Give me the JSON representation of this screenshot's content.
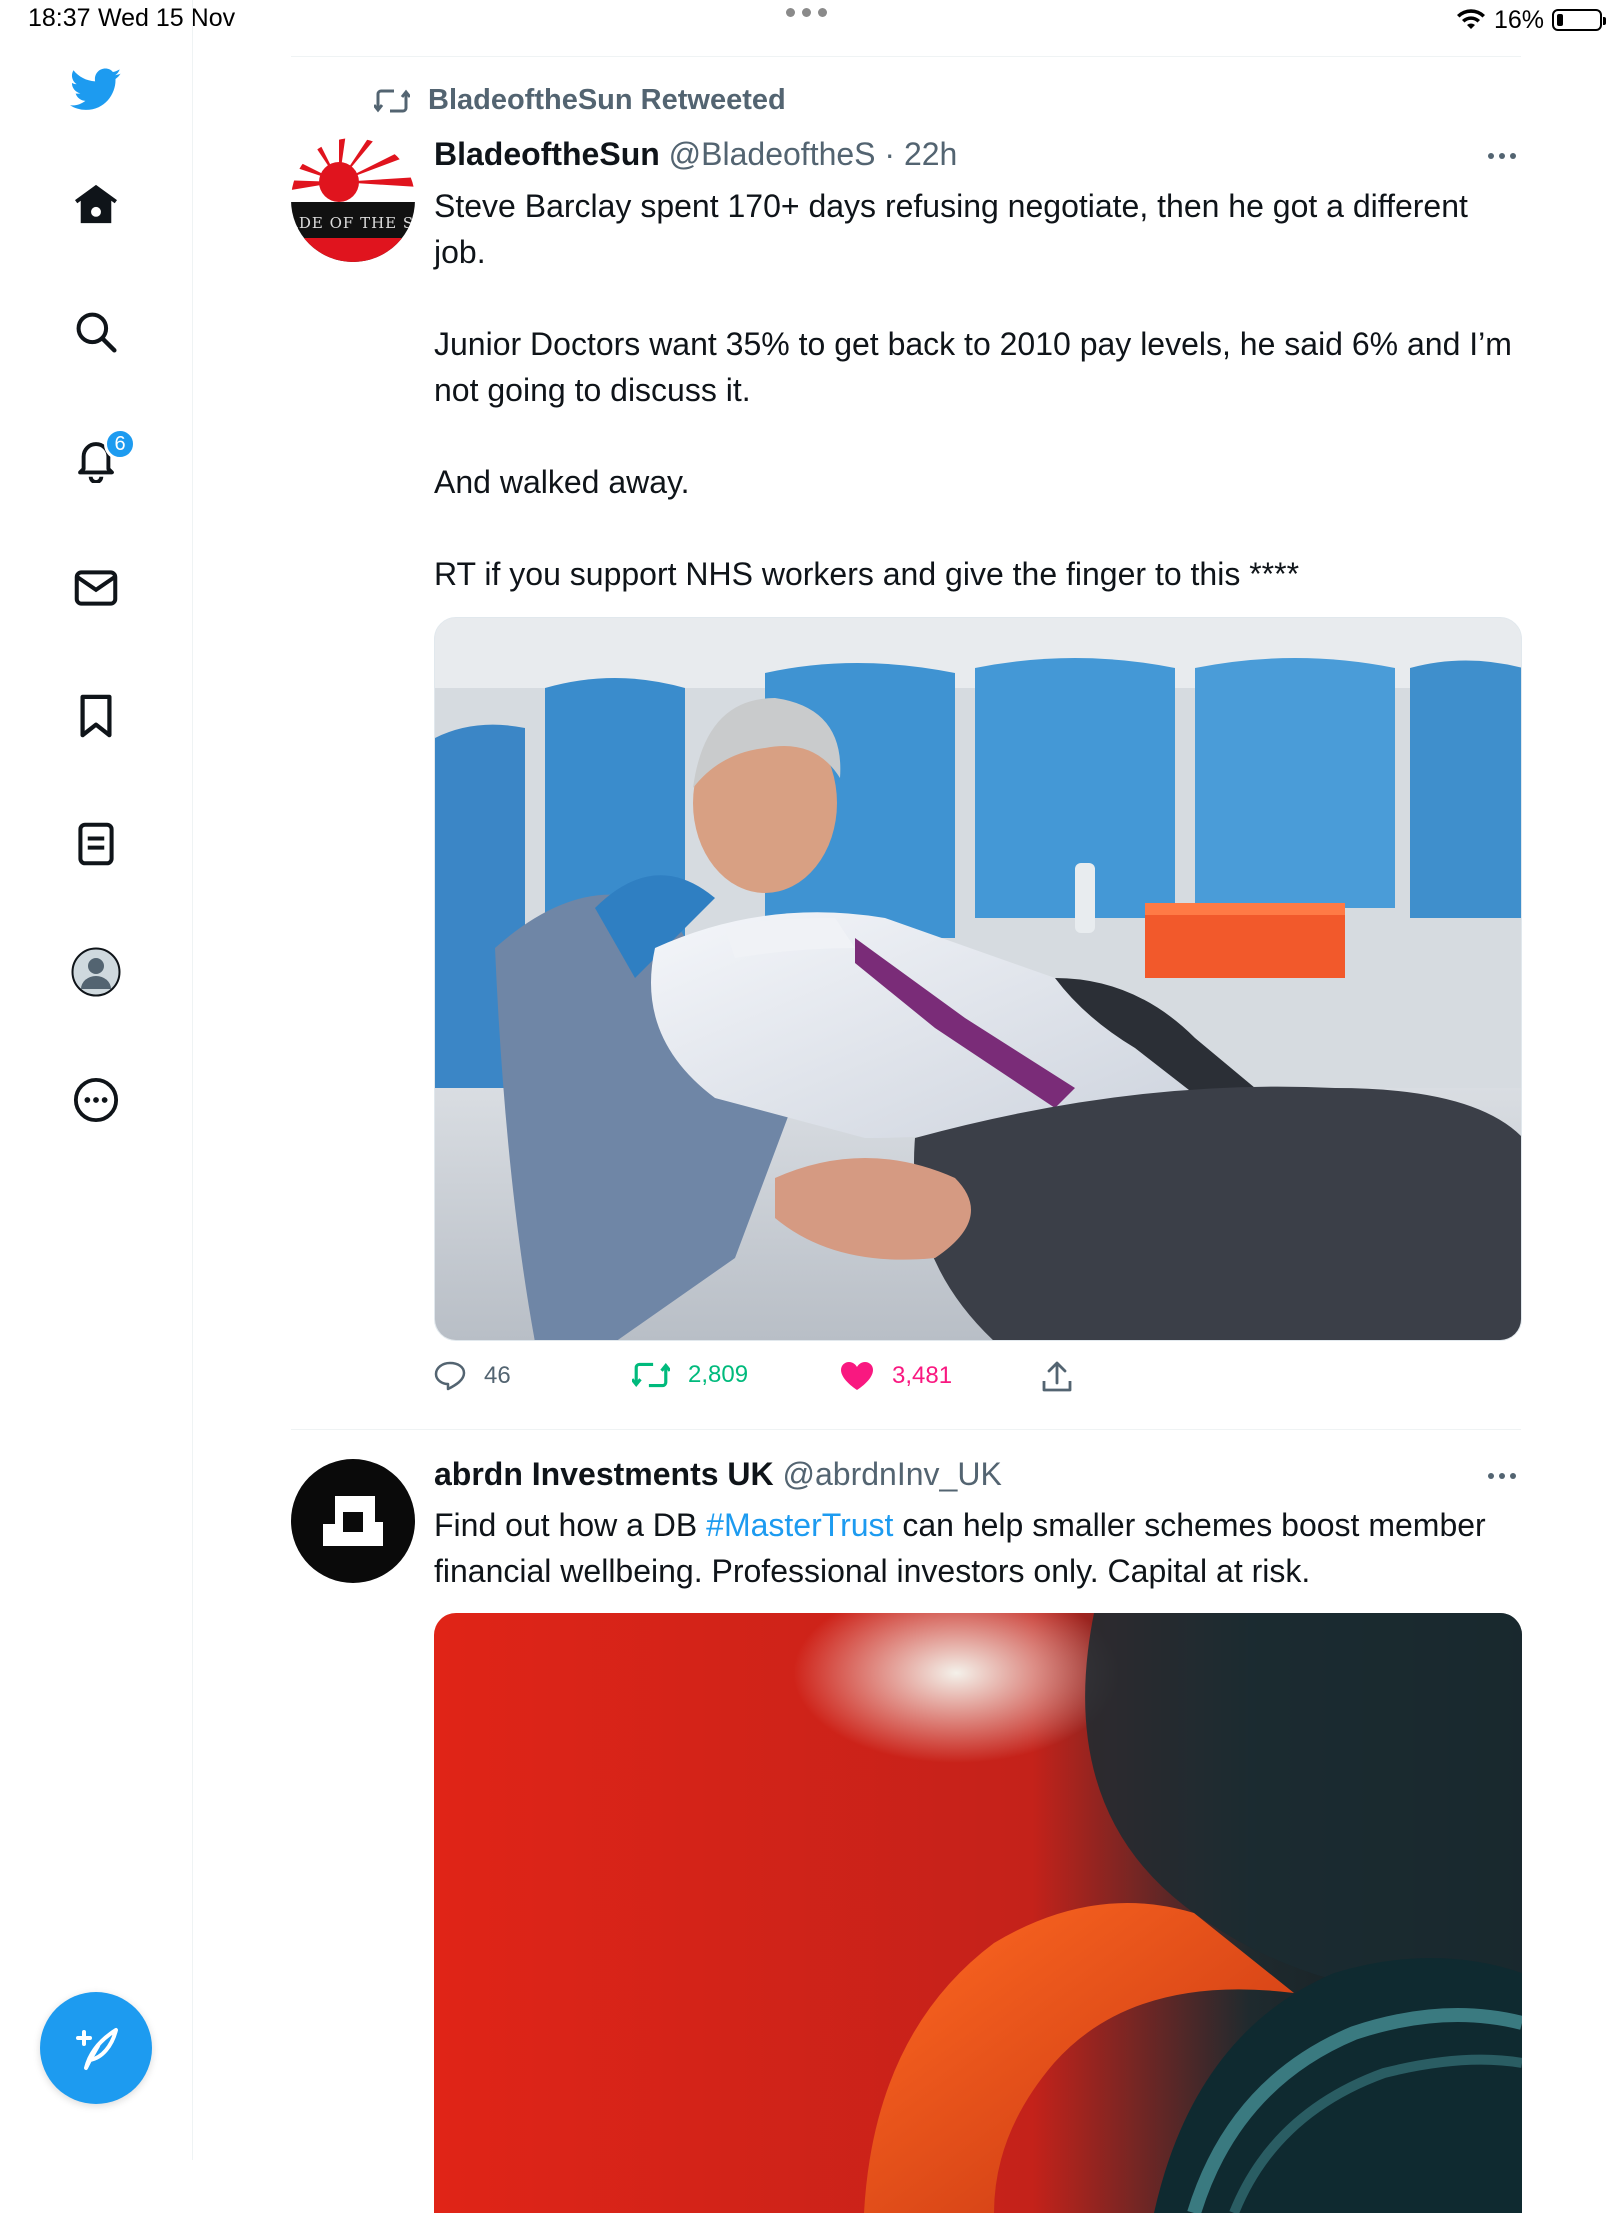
{
  "status_bar": {
    "time": "18:37",
    "date": "Wed 15 Nov",
    "battery_percent": "16%",
    "battery_level": 0.16,
    "wifi_icon": "wifi-icon"
  },
  "colors": {
    "accent": "#1d9bf0",
    "retweet_green": "#00ba7c",
    "like_pink": "#f91880",
    "secondary_text": "#536471"
  },
  "sidebar": {
    "items": [
      {
        "icon": "twitter-logo-icon"
      },
      {
        "icon": "home-icon"
      },
      {
        "icon": "search-icon"
      },
      {
        "icon": "bell-icon",
        "badge": "6"
      },
      {
        "icon": "mail-icon"
      },
      {
        "icon": "bookmark-icon"
      },
      {
        "icon": "list-icon"
      },
      {
        "icon": "profile-icon"
      },
      {
        "icon": "more-circle-icon"
      }
    ],
    "compose_icon": "compose-tweet-icon"
  },
  "tweet1": {
    "retweeted_by": "BladeoftheSun Retweeted",
    "name": "BladeoftheSun",
    "handle": "@BladeoftheS",
    "separator": "·",
    "time": "22h",
    "paragraphs": [
      "Steve Barclay spent 170+ days refusing negotiate, then he got a different job.",
      "Junior Doctors want 35% to get back to 2010 pay levels, he said 6% and I’m not going to discuss it.",
      "And walked away.",
      "RT if you support NHS workers and give the finger to this ****"
    ],
    "avatar_text": "BLADE OF THE SUN",
    "stats": {
      "replies": "46",
      "retweets": "2,809",
      "likes": "3,481"
    }
  },
  "tweet2": {
    "name": "abrdn Investments UK",
    "handle": "@abrdnInv_UK",
    "text_before": "Find out how a DB ",
    "hashtag": "#MasterTrust",
    "text_after": " can help smaller schemes boost member financial wellbeing. Professional investors only. Capital at risk."
  }
}
